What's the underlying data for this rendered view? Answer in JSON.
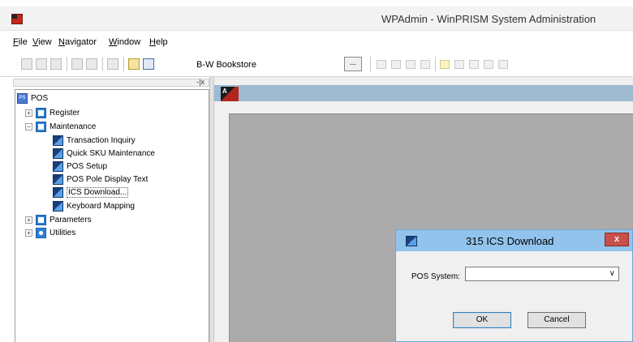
{
  "window": {
    "title": "WPAdmin - WinPRISM System Administration"
  },
  "menu": {
    "items": [
      {
        "mnemonic": "F",
        "rest": "ile"
      },
      {
        "mnemonic": "V",
        "rest": "iew"
      },
      {
        "mnemonic": "N",
        "rest": "avigator"
      },
      {
        "mnemonic": "W",
        "rest": "indow"
      },
      {
        "mnemonic": "H",
        "rest": "elp"
      }
    ]
  },
  "toolbar": {
    "store_label": "B-W Bookstore",
    "ellipsis_label": "..."
  },
  "navigator": {
    "close_glyph": "-|x",
    "tree": {
      "root": {
        "label": "POS",
        "icon": "pos-icon"
      },
      "groups": [
        {
          "label": "Register",
          "expander": "+",
          "icon": "folder-icon"
        },
        {
          "label": "Maintenance",
          "expander": "−",
          "icon": "folder-icon",
          "children": [
            {
              "label": "Transaction Inquiry"
            },
            {
              "label": "Quick SKU Maintenance"
            },
            {
              "label": "POS Setup"
            },
            {
              "label": "POS Pole Display Text"
            },
            {
              "label": "ICS Download...",
              "selected": true
            },
            {
              "label": "Keyboard Mapping"
            }
          ]
        },
        {
          "label": "Parameters",
          "expander": "+",
          "icon": "folder-icon"
        },
        {
          "label": "Utilities",
          "expander": "+",
          "icon": "gear-icon"
        }
      ]
    }
  },
  "document": {
    "icon_letter": "A"
  },
  "dialog": {
    "title": "315 ICS Download",
    "close_label": "x",
    "pos_system_label": "POS System:",
    "pos_system_value": "",
    "dropdown_arrow": "∨",
    "ok_label": "OK",
    "cancel_label": "Cancel"
  }
}
